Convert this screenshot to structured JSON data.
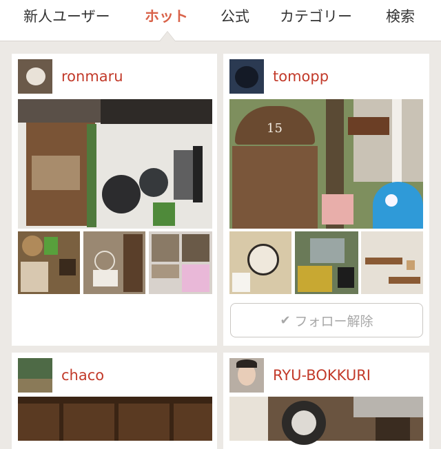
{
  "nav": {
    "tabs": [
      {
        "label": "新人ユーザー"
      },
      {
        "label": "ホット"
      },
      {
        "label": "公式"
      },
      {
        "label": "カテゴリー"
      },
      {
        "label": "検索"
      }
    ],
    "active_tab": "ホット"
  },
  "feed": {
    "cards": [
      {
        "username": "ronmaru"
      },
      {
        "username": "tomopp",
        "follow_label": "フォロー解除"
      },
      {
        "username": "chaco"
      },
      {
        "username": "RYU-BOKKURI"
      }
    ]
  },
  "colors": {
    "accent": "#d9634a",
    "username": "#c23a2a",
    "background": "#ece9e5"
  }
}
